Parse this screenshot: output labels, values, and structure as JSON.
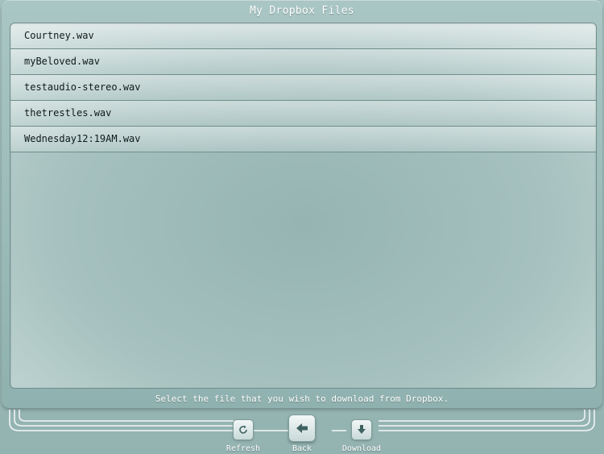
{
  "window": {
    "title": "My Dropbox Files"
  },
  "files": [
    {
      "name": "Courtney.wav"
    },
    {
      "name": "myBeloved.wav"
    },
    {
      "name": "testaudio-stereo.wav"
    },
    {
      "name": "thetrestles.wav"
    },
    {
      "name": "Wednesday12:19AM.wav"
    }
  ],
  "hint": "Select the file that you wish to download from Dropbox.",
  "toolbar": {
    "refresh_label": "Refresh",
    "back_label": "Back",
    "download_label": "Download",
    "refresh_icon": "refresh-icon",
    "back_icon": "back-arrow-icon",
    "download_icon": "download-arrow-icon"
  },
  "colors": {
    "panel": "#a9c6c4",
    "text_light": "#ffffff",
    "text_dark": "#0f1a1a",
    "accent": "#3f6260"
  }
}
